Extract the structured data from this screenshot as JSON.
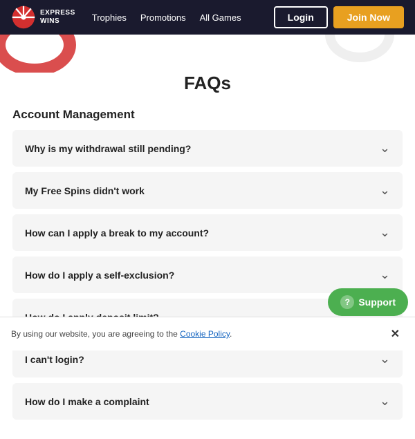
{
  "header": {
    "logo_text": "EXPRESS\nWINS",
    "nav": [
      {
        "label": "Trophies",
        "id": "trophies"
      },
      {
        "label": "Promotions",
        "id": "promotions"
      },
      {
        "label": "All Games",
        "id": "all-games"
      }
    ],
    "login_label": "Login",
    "join_label": "Join Now"
  },
  "page": {
    "title": "FAQs",
    "section_title": "Account Management"
  },
  "faq_items": [
    {
      "id": "faq-1",
      "question": "Why is my withdrawal still pending?"
    },
    {
      "id": "faq-2",
      "question": "My Free Spins didn't work"
    },
    {
      "id": "faq-3",
      "question": "How can I apply a break to my account?"
    },
    {
      "id": "faq-4",
      "question": "How do I apply a self-exclusion?"
    },
    {
      "id": "faq-5",
      "question": "How do I apply deposit limit?"
    },
    {
      "id": "faq-6",
      "question": "I can't login?"
    },
    {
      "id": "faq-7",
      "question": "How do I make a complaint"
    }
  ],
  "cookie_banner": {
    "text_prefix": "By using our website, you are agreeing to the ",
    "link_text": "Cookie Policy",
    "text_suffix": "."
  },
  "support": {
    "label": "Support"
  },
  "colors": {
    "header_bg": "#1a1a2e",
    "accent_orange": "#e8a020",
    "accent_red": "#d32f2f",
    "support_green": "#4caf50"
  }
}
